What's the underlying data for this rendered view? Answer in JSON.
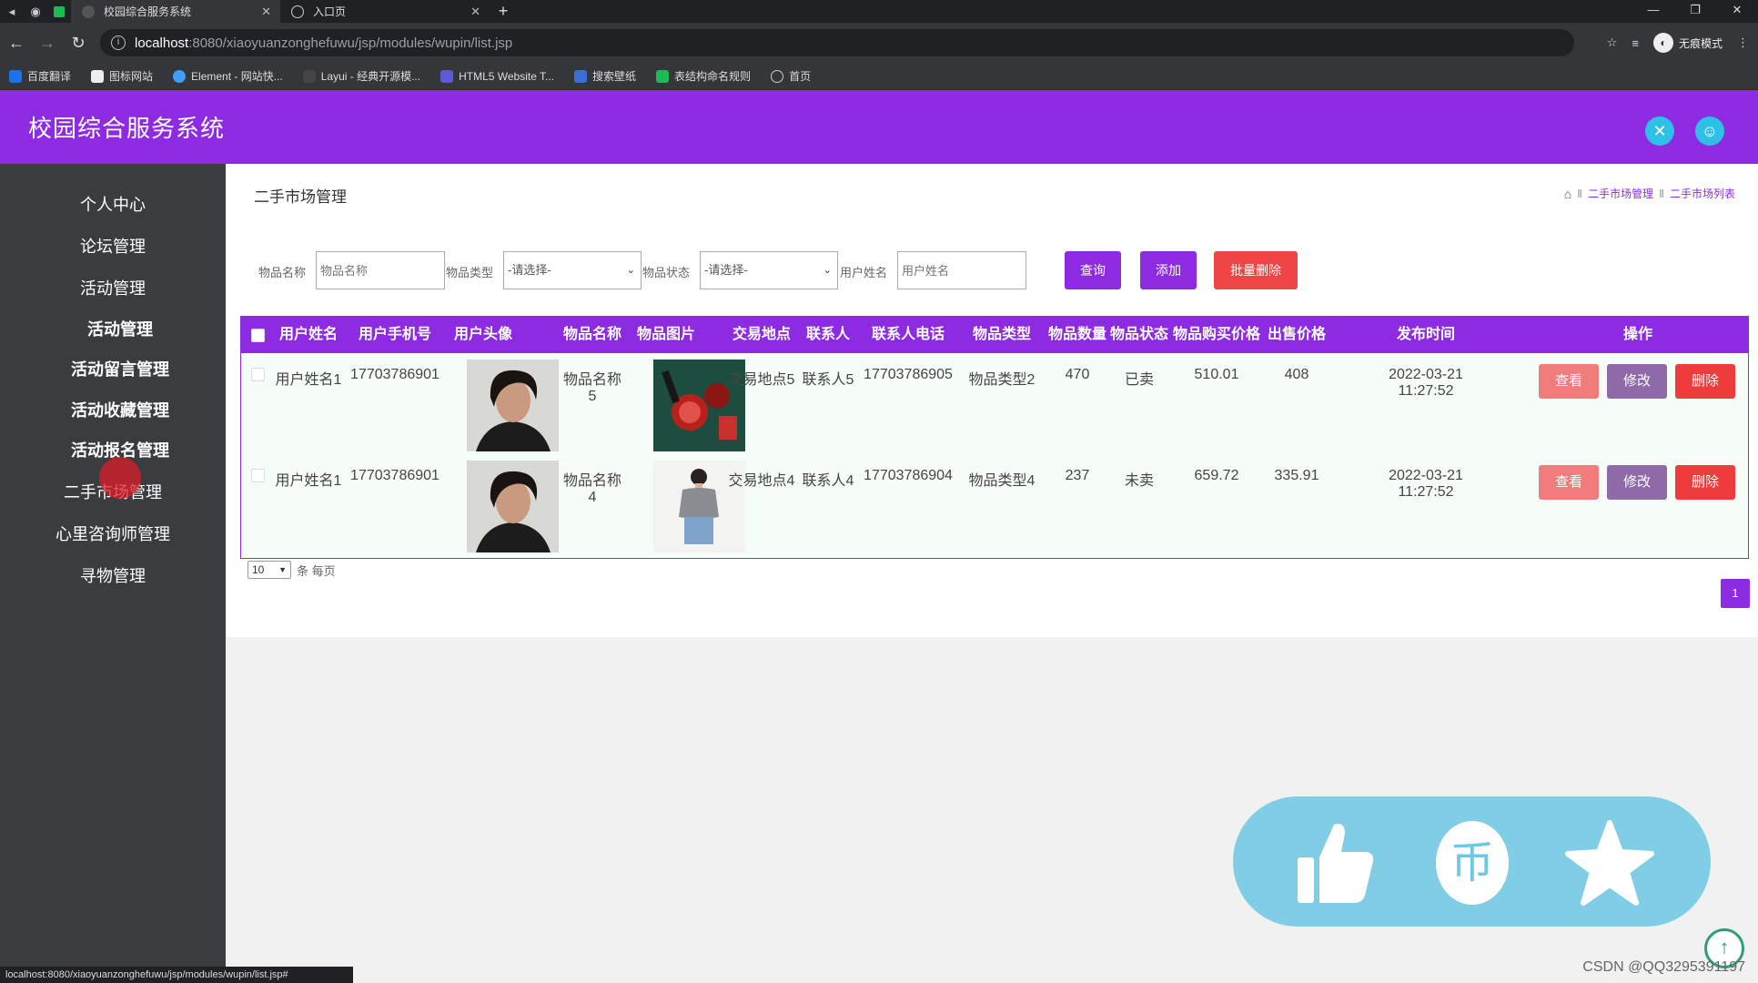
{
  "browser": {
    "tabs": [
      {
        "title": "校园综合服务系统",
        "active": true
      },
      {
        "title": "入口页",
        "active": false
      }
    ],
    "new_tab": "+",
    "url_host": "localhost",
    "url_path": ":8080/xiaoyuanzonghefuwu/jsp/modules/wupin/list.jsp",
    "profile_label": "无痕模式",
    "bookmarks": [
      "百度翻译",
      "图标网站",
      "Element - 网站快...",
      "Layui - 经典开源模...",
      "HTML5 Website T...",
      "搜索壁纸",
      "表结构命名规则",
      "首页"
    ],
    "status_url": "localhost:8080/xiaoyuanzonghefuwu/jsp/modules/wupin/list.jsp#"
  },
  "app": {
    "title": "校园综合服务系统",
    "accent": "#8c2be2"
  },
  "sidebar": {
    "items": [
      "个人中心",
      "论坛管理",
      "活动管理",
      "活动管理",
      "活动留言管理",
      "活动收藏管理",
      "活动报名管理",
      "二手市场管理",
      "心里咨询师管理",
      "寻物管理"
    ]
  },
  "main": {
    "heading": "二手市场管理",
    "breadcrumb": [
      "二手市场管理",
      "二手市场列表"
    ],
    "search": {
      "name_label": "物品名称",
      "name_placeholder": "物品名称",
      "type_label": "物品类型",
      "type_value": "-请选择-",
      "status_label": "物品状态",
      "status_value": "-请选择-",
      "user_label": "用户姓名",
      "user_placeholder": "用户姓名",
      "query_btn": "查询",
      "add_btn": "添加",
      "batch_delete_btn": "批量删除"
    },
    "table": {
      "headers": [
        "用户姓名",
        "用户手机号",
        "用户头像",
        "物品名称",
        "物品图片",
        "交易地点",
        "联系人",
        "联系人电话",
        "物品类型",
        "物品数量",
        "物品状态",
        "物品购买价格",
        "出售价格",
        "发布时间",
        "操作"
      ],
      "rows": [
        {
          "user_name": "用户姓名1",
          "phone": "17703786901",
          "item_name": "物品名称5",
          "location": "交易地点5",
          "contact": "联系人5",
          "contact_phone": "17703786905",
          "item_type": "物品类型2",
          "quantity": "470",
          "status": "已卖",
          "buy_price": "510.01",
          "sell_price": "408",
          "time": "2022-03-21 11:27:52"
        },
        {
          "user_name": "用户姓名1",
          "phone": "17703786901",
          "item_name": "物品名称4",
          "location": "交易地点4",
          "contact": "联系人4",
          "contact_phone": "17703786904",
          "item_type": "物品类型4",
          "quantity": "237",
          "status": "未卖",
          "buy_price": "659.72",
          "sell_price": "335.91",
          "time": "2022-03-21 11:27:52"
        }
      ],
      "actions": {
        "view": "查看",
        "edit": "修改",
        "delete": "删除"
      }
    },
    "pagination": {
      "page_size": "10",
      "per_page_label": "条 每页",
      "current_page": "1"
    }
  },
  "watermark": "CSDN @QQ3295391197"
}
